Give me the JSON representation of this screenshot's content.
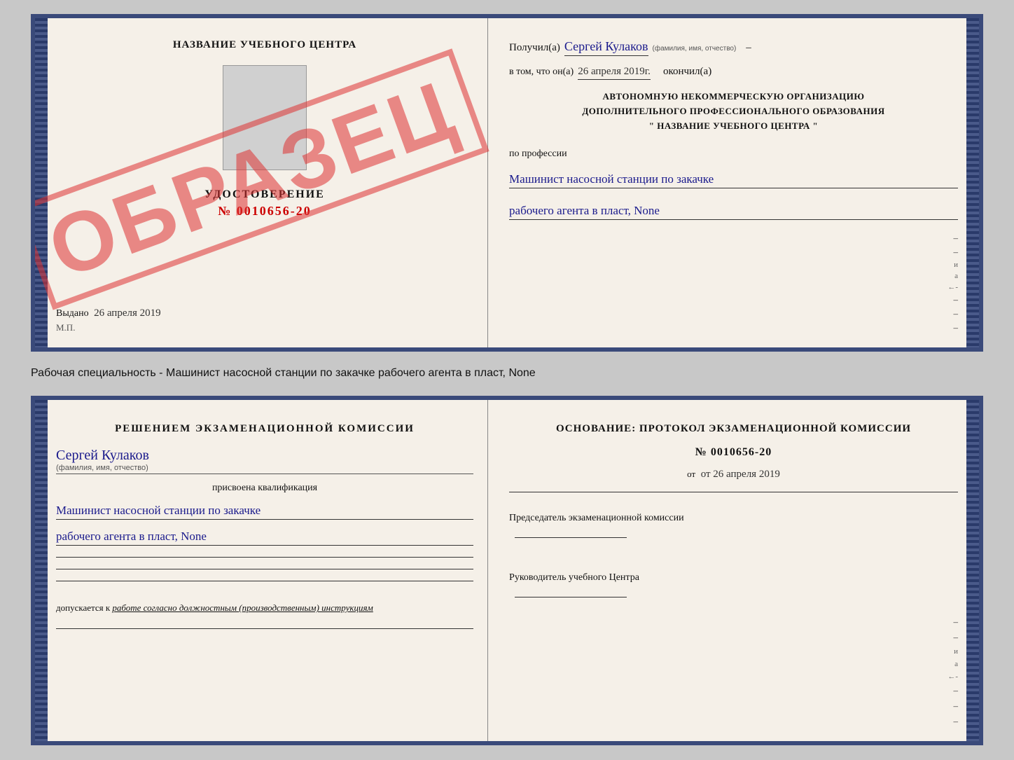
{
  "top_doc": {
    "left": {
      "center_title": "НАЗВАНИЕ УЧЕБНОГО ЦЕНТРА",
      "watermark": "ОБРАЗЕЦ",
      "udostoverenie_title": "УДОСТОВЕРЕНИЕ",
      "udostoverenie_number": "№ 0010656-20",
      "vydano_label": "Выдано",
      "vydano_date": "26 апреля 2019",
      "mp_label": "М.П."
    },
    "right": {
      "poluchil_label": "Получил(а)",
      "poluchil_name": "Сергей Кулаков",
      "poluchil_hint": "(фамилия, имя, отчество)",
      "vtom_label": "в том, что он(а)",
      "vtom_date": "26 апреля 2019г.",
      "okonchil_label": "окончил(а)",
      "org_line1": "АВТОНОМНУЮ НЕКОММЕРЧЕСКУЮ ОРГАНИЗАЦИЮ",
      "org_line2": "ДОПОЛНИТЕЛЬНОГО ПРОФЕССИОНАЛЬНОГО ОБРАЗОВАНИЯ",
      "org_line3": "\" НАЗВАНИЕ УЧЕБНОГО ЦЕНТРА \"",
      "po_professii_label": "по профессии",
      "profession_line1": "Машинист насосной станции по закачке",
      "profession_line2": "рабочего агента в пласт, None"
    }
  },
  "specialty_label": "Рабочая специальность - Машинист насосной станции по закачке рабочего агента в пласт, None",
  "bottom_doc": {
    "left": {
      "komissia_title": "Решением экзаменационной комиссии",
      "fio": "Сергей Кулаков",
      "fio_hint": "(фамилия, имя, отчество)",
      "prisvoena_label": "присвоена квалификация",
      "qualification_line1": "Машинист насосной станции по закачке",
      "qualification_line2": "рабочего агента в пласт, None",
      "dopuskaetsya_label": "допускается к",
      "dopuskaetsya_text": "работе согласно должностным (производственным) инструкциям"
    },
    "right": {
      "osnovanie_label": "Основание: протокол экзаменационной комиссии",
      "protokol_number": "№ 0010656-20",
      "ot_date": "от 26 апреля 2019",
      "predsedatel_label": "Председатель экзаменационной комиссии",
      "rukovoditel_label": "Руководитель учебного Центра"
    }
  }
}
